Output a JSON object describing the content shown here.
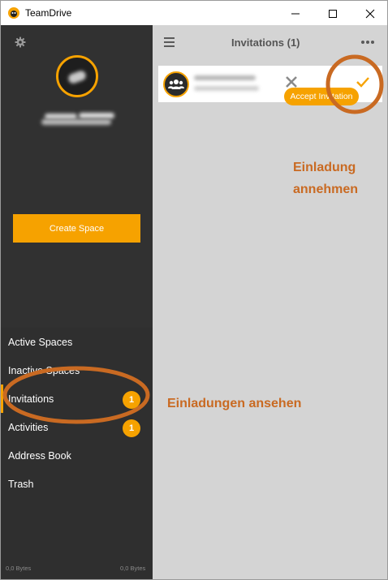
{
  "window": {
    "title": "TeamDrive",
    "controls": [
      "minimize",
      "maximize",
      "close"
    ]
  },
  "sidebar": {
    "settings_icon": "gear-icon",
    "create_space_label": "Create Space",
    "items": [
      {
        "label": "Active Spaces",
        "badge": null
      },
      {
        "label": "Inactive Spaces",
        "badge": null
      },
      {
        "label": "Invitations",
        "badge": "1",
        "active": true
      },
      {
        "label": "Activities",
        "badge": "1"
      },
      {
        "label": "Address Book",
        "badge": null
      },
      {
        "label": "Trash",
        "badge": null
      }
    ],
    "storage_left": "0,0 Bytes",
    "storage_right": "0,0 Bytes"
  },
  "main": {
    "title": "Invitations (1)",
    "menu_icon": "hamburger-icon",
    "more_icon": "more-dots-icon",
    "invitation": {
      "avatar_icon": "group-icon",
      "decline_icon": "close-icon",
      "accept_icon": "checkmark-icon",
      "tooltip": "Accept Invitation"
    }
  },
  "annotations": {
    "accept_note_line1": "Einladung",
    "accept_note_line2": "annehmen",
    "view_note": "Einladungen ansehen"
  },
  "colors": {
    "accent": "#f6a200",
    "annotation": "#c96a22",
    "sidebar_bg": "#2f2f2f",
    "main_bg": "#d4d4d4"
  }
}
